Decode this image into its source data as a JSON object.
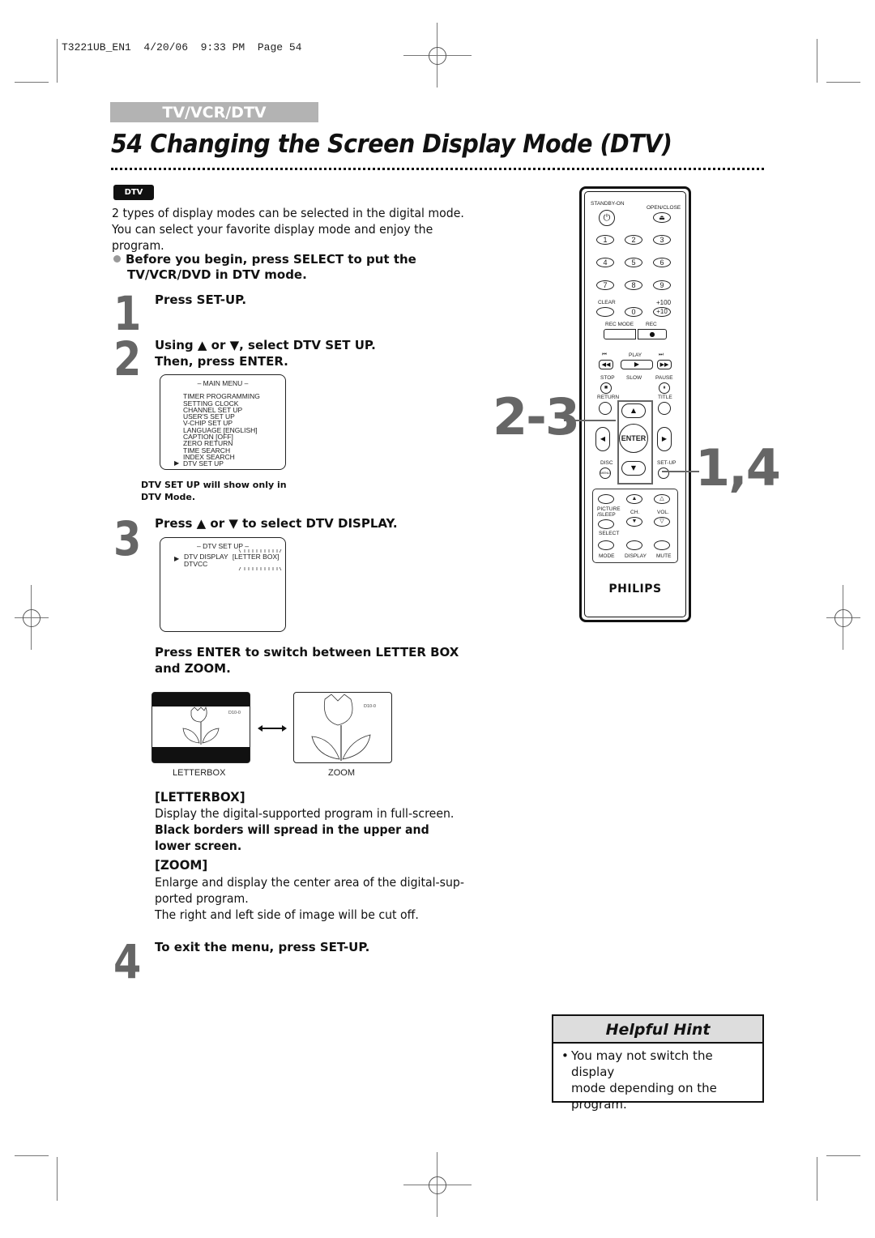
{
  "slug": "T3221UB_EN1  4/20/06  9:33 PM  Page 54",
  "section_tab": "TV/VCR/DTV",
  "page_title": "54  Changing the Screen Display Mode (DTV)",
  "dtv_badge": "DTV",
  "intro": {
    "line1": "2 types of display modes can be selected in the digital mode.",
    "line2": "You can select your favorite display mode and enjoy the",
    "line3": "program."
  },
  "bullet_note": {
    "line1": "Before you begin, press SELECT to put the",
    "line2": "TV/VCR/DVD in DTV mode."
  },
  "steps": [
    {
      "number": "1",
      "text": "Press SET-UP."
    },
    {
      "number": "2",
      "text_line1": "Using ▲ or ▼, select DTV SET UP.",
      "text_line2": "Then, press ENTER."
    },
    {
      "number": "3",
      "text": "Press ▲ or ▼ to select DTV DISPLAY."
    },
    {
      "number": "4",
      "text": "To exit the menu, press SET-UP."
    }
  ],
  "main_menu": {
    "title": "– MAIN MENU –",
    "items": [
      "TIMER PROGRAMMING",
      "SETTING CLOCK",
      "CHANNEL SET UP",
      "USER'S SET UP",
      "V-CHIP SET UP",
      "LANGUAGE  [ENGLISH]",
      "CAPTION  [OFF]",
      "ZERO RETURN",
      "TIME SEARCH",
      "INDEX SEARCH",
      "DTV SET UP"
    ],
    "selected": "DTV SET UP"
  },
  "menu_note": {
    "line1": "DTV SET UP will show only in",
    "line2": "DTV Mode."
  },
  "dtv_setup_menu": {
    "title": "– DTV SET UP –",
    "items": [
      {
        "label": "DTV DISPLAY",
        "value": "[LETTER BOX]"
      },
      {
        "label": "DTVCC",
        "value": ""
      }
    ],
    "selected": "DTV DISPLAY"
  },
  "switch_instruction": {
    "line1": "Press ENTER to switch between LETTER BOX",
    "line2": "and ZOOM."
  },
  "illustrations": {
    "letterbox_caption": "LETTERBOX",
    "zoom_caption": "ZOOM",
    "channel_label": "D10-0"
  },
  "letterbox_section": {
    "heading": "[LETTERBOX]",
    "text": "Display the digital-supported program in full-screen.",
    "bold_line1": "Black borders will spread in the upper and",
    "bold_line2": "lower screen."
  },
  "zoom_section": {
    "heading": "[ZOOM]",
    "line1": "Enlarge and display the center area of the digital-sup-",
    "line2": "ported program.",
    "line3": "The right and left side of image will be cut off."
  },
  "callouts": {
    "upper": "2-3",
    "lower": "1,4"
  },
  "remote": {
    "brand": "PHILIPS",
    "labels": {
      "standby": "STANDBY-ON",
      "open_close": "OPEN/CLOSE",
      "clear": "CLEAR",
      "plus100": "+100",
      "plus10": "+10",
      "rec_mode": "REC MODE",
      "rec": "REC",
      "play": "PLAY",
      "stop": "STOP",
      "slow": "SLOW",
      "pause": "PAUSE",
      "return": "RETURN",
      "title": "TITLE",
      "enter": "ENTER",
      "disc": "DISC",
      "menu": "MENU",
      "setup": "SET-UP",
      "picture_sleep_1": "PICTURE",
      "picture_sleep_2": "/SLEEP",
      "ch": "CH.",
      "vol": "VOL.",
      "select": "SELECT",
      "mode": "MODE",
      "display": "DISPLAY",
      "mute": "MUTE"
    },
    "digits": [
      "1",
      "2",
      "3",
      "4",
      "5",
      "6",
      "7",
      "8",
      "9",
      "0"
    ]
  },
  "helpful_hint": {
    "title": "Helpful Hint",
    "bullet": "•",
    "line1": "You may not switch the display",
    "line2": "mode depending on the",
    "line3": "program."
  }
}
